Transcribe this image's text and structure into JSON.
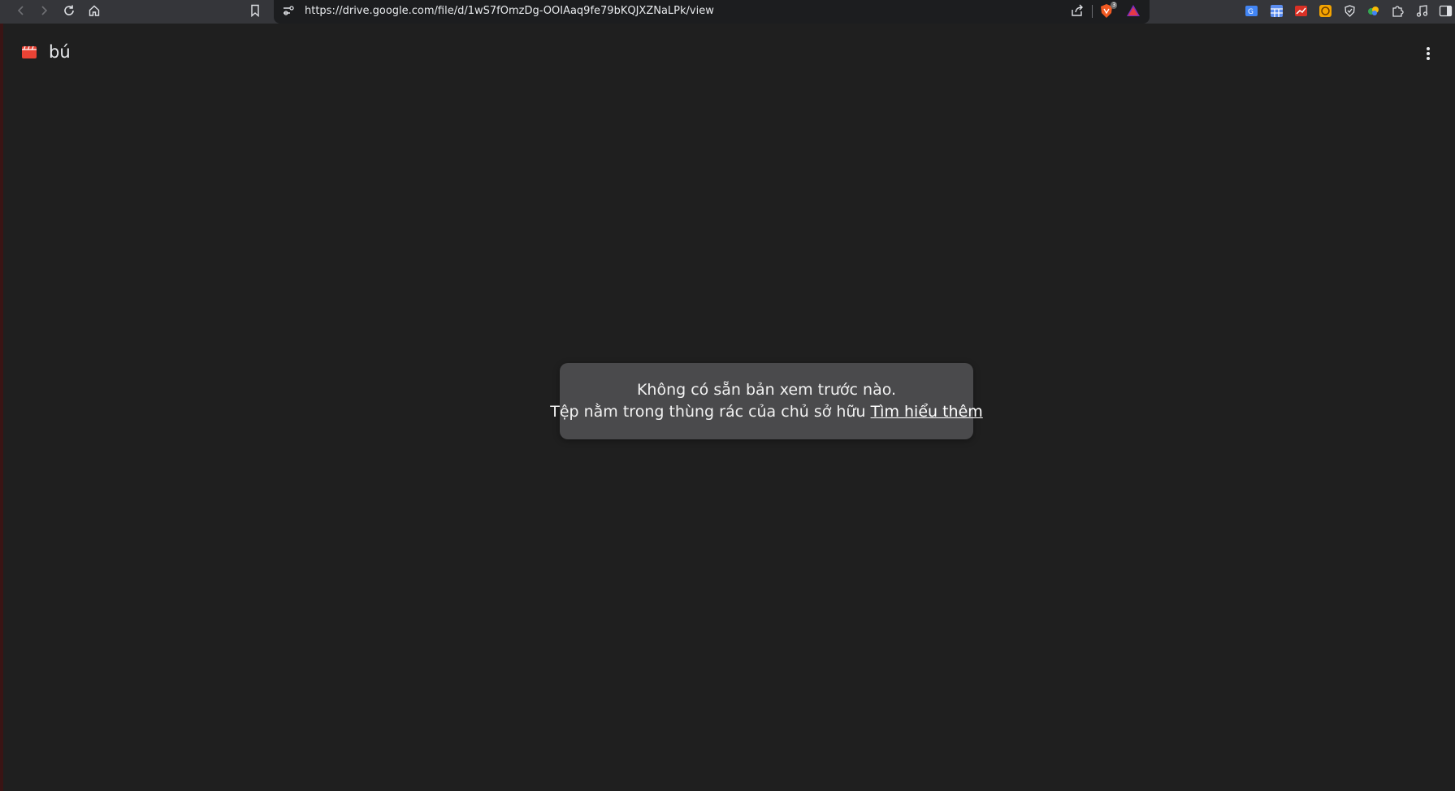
{
  "browser": {
    "url": "https://drive.google.com/file/d/1wS7fOmzDg-OOIAaq9fe79bKQJXZNaLPk/view",
    "shield_badge": "3",
    "nav_icons": [
      "back-icon",
      "forward-icon",
      "reload-icon",
      "home-icon",
      "bookmark-icon"
    ],
    "omnibox_icons": [
      "site-info-icon",
      "share-icon",
      "brave-shield-icon",
      "brave-rewards-icon"
    ],
    "extension_icons": [
      "translate-extension-icon",
      "grid-extension-icon",
      "chart-extension-icon",
      "coin-extension-icon",
      "shield-extension-icon",
      "leaf-extension-icon",
      "extensions-puzzle-icon",
      "media-music-icon",
      "sidebar-panel-icon"
    ]
  },
  "file": {
    "name": "bú",
    "icon": "video-file-icon",
    "more_icon": "more-vert-icon"
  },
  "message": {
    "line1": "Không có sẵn bản xem trước nào.",
    "line2": "Tệp nằm trong thùng rác của chủ sở hữu",
    "link": "Tìm hiểu thêm"
  },
  "colors": {
    "background": "#1f1f1f",
    "toolbar": "#35363a",
    "card": "#4a4a4c",
    "video_icon": "#ea4335"
  }
}
